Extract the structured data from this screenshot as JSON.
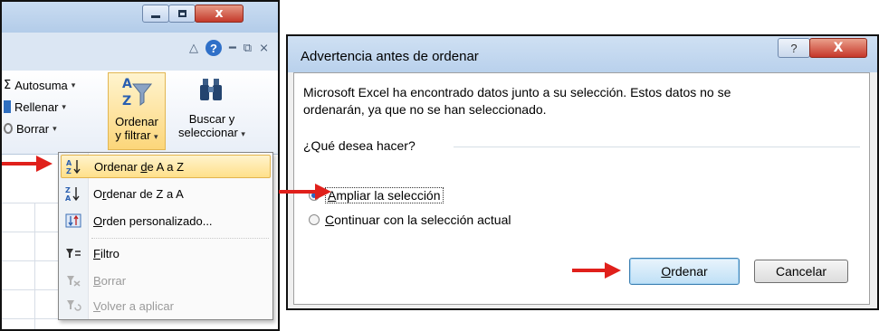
{
  "excel": {
    "window_buttons": {
      "close": "x"
    },
    "ribbon": {
      "autosum_label": "Autosuma",
      "fill_label": "Rellenar",
      "clear_label": "Borrar",
      "sort_filter_line1": "Ordenar",
      "sort_filter_line2": "y filtrar",
      "find_select_line1": "Buscar y",
      "find_select_line2": "seleccionar"
    },
    "menu": {
      "items": [
        {
          "label_pre": "Ordenar ",
          "accel": "d",
          "label_post": "e A a Z",
          "icon": "sort-a-z-icon"
        },
        {
          "label_pre": "O",
          "accel": "r",
          "label_post": "denar de Z a A",
          "icon": "sort-z-a-icon"
        },
        {
          "label_pre": "",
          "accel": "O",
          "label_post": "rden personalizado...",
          "icon": "custom-sort-icon"
        },
        {
          "label_pre": "",
          "accel": "F",
          "label_post": "iltro",
          "icon": "filter-icon"
        },
        {
          "label_pre": "",
          "accel": "B",
          "label_post": "orrar",
          "icon": "clear-filter-icon"
        },
        {
          "label_pre": "",
          "accel": "V",
          "label_post": "olver a aplicar",
          "icon": "reapply-icon"
        }
      ]
    }
  },
  "dialog": {
    "title": "Advertencia antes de ordenar",
    "help_glyph": "?",
    "close_glyph": "X",
    "message_line1": "Microsoft Excel ha encontrado datos junto a su selección. Estos datos no se",
    "message_line2": "ordenarán, ya que no se han seleccionado.",
    "question": "¿Qué desea hacer?",
    "options": [
      {
        "accel": "A",
        "rest": "mpliar la selección",
        "selected": true
      },
      {
        "accel": "C",
        "rest": "ontinuar con la selección actual",
        "selected": false
      }
    ],
    "ok": {
      "accel": "O",
      "rest": "rdenar"
    },
    "cancel_label": "Cancelar"
  },
  "colors": {
    "arrow": "#e0201b",
    "accent": "#2a66c0"
  }
}
